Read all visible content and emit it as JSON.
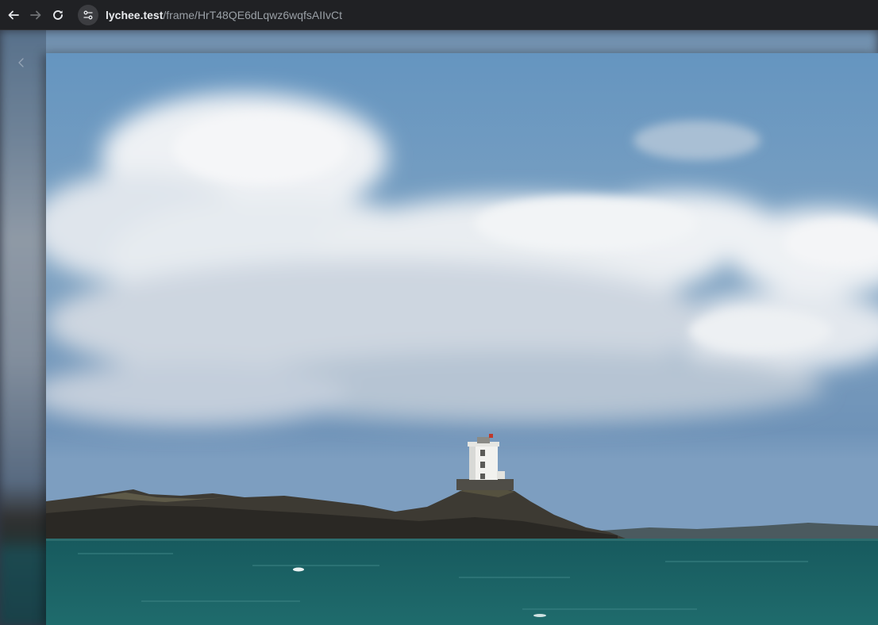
{
  "browser": {
    "back_icon": "arrow-left-icon",
    "forward_icon": "arrow-right-icon",
    "reload_icon": "reload-icon",
    "site_info_icon": "tune-icon",
    "url_host": "lychee.test",
    "url_path": "/frame/HrT48QE6dLqwz6wqfsAIIvCt"
  },
  "frame": {
    "prev_icon": "chevron-left-icon",
    "photo_icon": "lighthouse-photo"
  },
  "colors": {
    "toolbar": "#202124",
    "sky_top": "#6a98c2",
    "sea": "#1d5f63"
  }
}
